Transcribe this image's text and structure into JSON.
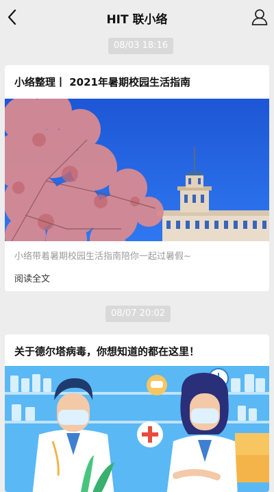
{
  "header": {
    "title": "HIT 联小络",
    "back_icon": "chevron-left-icon",
    "profile_icon": "person-icon"
  },
  "messages": [
    {
      "time": "08/03 18:16",
      "title": "小络整理丨 2021年暑期校园生活指南",
      "summary": "小络带着暑期校园生活指南陪你一起过暑假~",
      "read_more": "阅读全文"
    },
    {
      "time": "08/07 20:02",
      "title": "关于德尔塔病毒，你想知道的都在这里！"
    }
  ],
  "colors": {
    "background": "#ededed",
    "card": "#ffffff",
    "sky": "#1f5fe0",
    "blossom": "#d77d86",
    "illustration_bg": "#5ab8f5"
  }
}
